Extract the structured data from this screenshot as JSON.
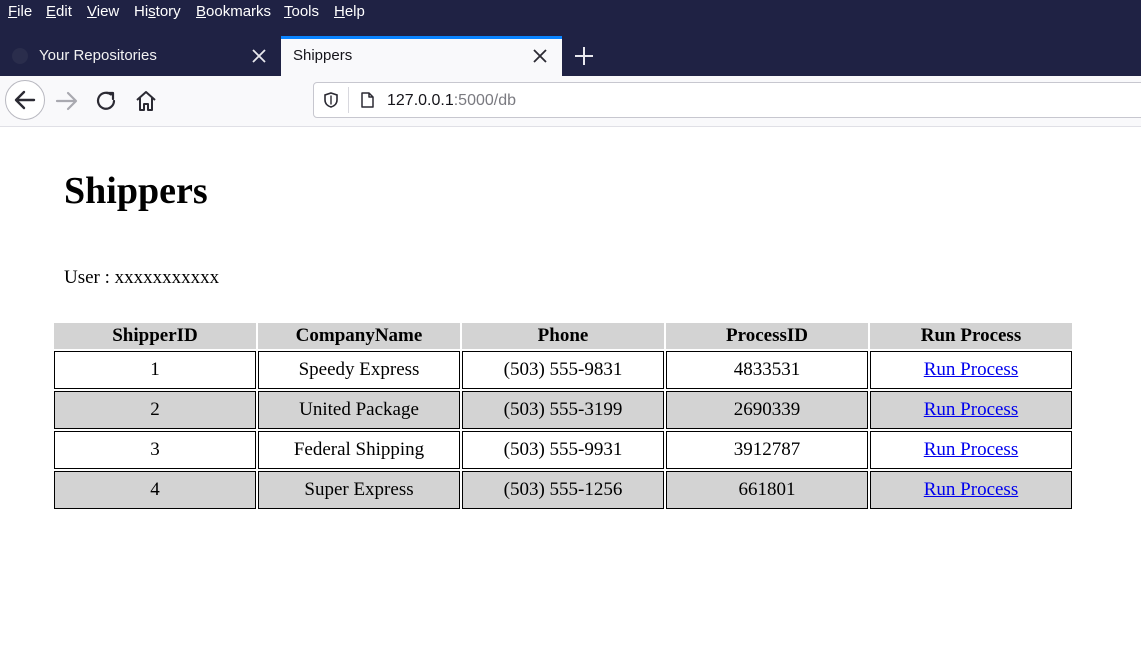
{
  "menu": [
    {
      "key": "F",
      "rest": "ile"
    },
    {
      "key": "E",
      "rest": "dit"
    },
    {
      "key": "V",
      "rest": "iew"
    },
    {
      "pre": "Hi",
      "key": "s",
      "rest": "tory"
    },
    {
      "key": "B",
      "rest": "ookmarks"
    },
    {
      "key": "T",
      "rest": "ools"
    },
    {
      "key": "H",
      "rest": "elp"
    }
  ],
  "tabs": [
    {
      "label": "Your Repositories",
      "active": false
    },
    {
      "label": "Shippers",
      "active": true
    }
  ],
  "url": {
    "host": "127.0.0.1",
    "rest": ":5000/db"
  },
  "page": {
    "title": "Shippers",
    "user_label": "User :",
    "user_value": "xxxxxxxxxxx"
  },
  "table": {
    "headers": [
      "ShipperID",
      "CompanyName",
      "Phone",
      "ProcessID",
      "Run Process"
    ],
    "rows": [
      {
        "id": "1",
        "company": "Speedy Express",
        "phone": "(503) 555-9831",
        "process_id": "4833531",
        "action": "Run Process"
      },
      {
        "id": "2",
        "company": "United Package",
        "phone": "(503) 555-3199",
        "process_id": "2690339",
        "action": "Run Process"
      },
      {
        "id": "3",
        "company": "Federal Shipping",
        "phone": "(503) 555-9931",
        "process_id": "3912787",
        "action": "Run Process"
      },
      {
        "id": "4",
        "company": "Super Express",
        "phone": "(503) 555-1256",
        "process_id": "661801",
        "action": "Run Process"
      }
    ]
  },
  "colors": {
    "chrome": "#1f2244",
    "tab_accent": "#0a84ff",
    "link": "#0000ee",
    "row_shade": "#d3d3d3"
  },
  "icons": [
    "close-icon",
    "plus-icon",
    "back-arrow-icon",
    "forward-arrow-icon",
    "reload-icon",
    "home-icon",
    "shield-icon",
    "page-icon"
  ]
}
